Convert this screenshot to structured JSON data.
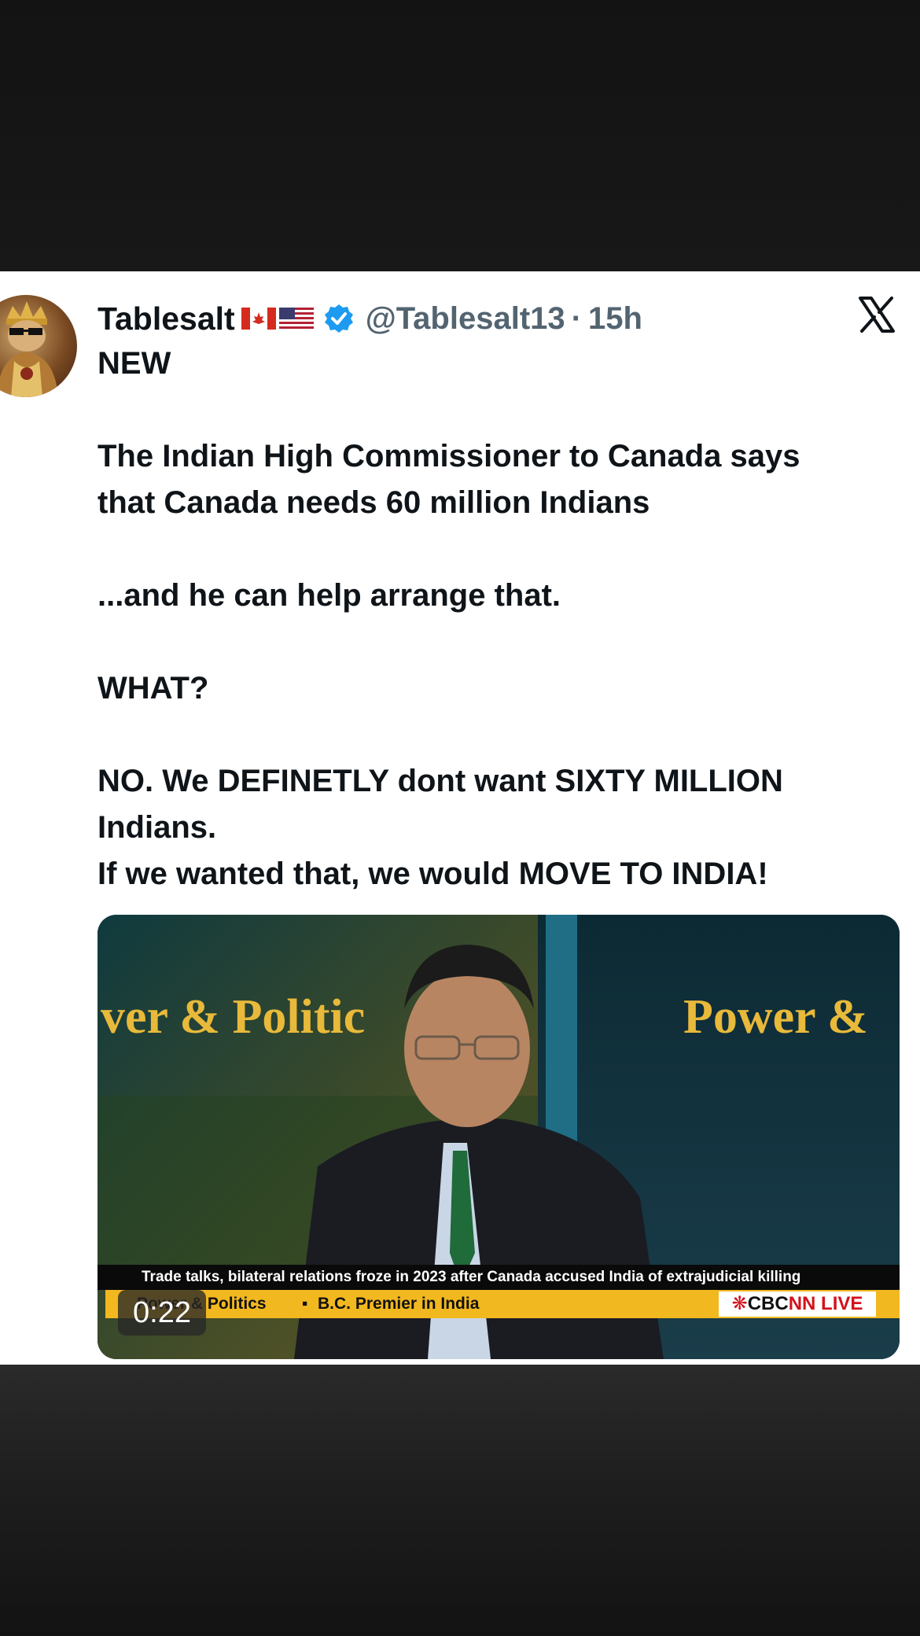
{
  "tweet": {
    "display_name": "Tablesalt",
    "flags": [
      "canada-flag",
      "us-flag"
    ],
    "handle": "@Tablesalt13",
    "separator": "·",
    "time": "15h",
    "lines": [
      "NEW",
      "",
      "The Indian High Commissioner to Canada says",
      "that Canada needs 60 million Indians",
      "",
      "...and he can help arrange that.",
      "",
      "WHAT?",
      "",
      "NO. We DEFINETLY dont want SIXTY MILLION",
      "Indians.",
      "If we wanted that, we would MOVE TO INDIA!"
    ]
  },
  "video": {
    "logo_left": "ver & Politic",
    "logo_right": "Power &",
    "headline": "Trade talks, bilateral relations froze in 2023 after Canada accused India of extrajudicial killing",
    "show_name": "Power & Politics",
    "separator": "▪",
    "story": "B.C. Premier in India",
    "network_prefix": "CBC",
    "network_suffix": "NN LIVE",
    "duration": "0:22"
  },
  "colors": {
    "text": "#0f1419",
    "muted": "#536471",
    "verified": "#1d9bf0",
    "ticker_yellow": "#f2b81f",
    "cbc_red": "#d3111b"
  },
  "icons": {
    "verified": "verified-badge-icon",
    "platform": "x-logo-icon"
  }
}
